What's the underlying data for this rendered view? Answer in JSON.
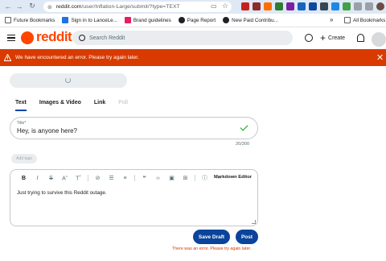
{
  "browser": {
    "url_host": "reddit.com",
    "url_path": "/user/Inflation-Large/submit/?type=TEXT",
    "bookmarks": [
      {
        "label": "Future Bookmarks",
        "icon": "folder-icon"
      },
      {
        "label": "Sign in to LanceLe...",
        "icon": "page-icon"
      },
      {
        "label": "Brand guidelines",
        "icon": "page-icon"
      },
      {
        "label": "Page Report",
        "icon": "page-icon"
      },
      {
        "label": "New Paid Contribu...",
        "icon": "page-icon"
      }
    ],
    "all_bookmarks": "All Bookmarks",
    "more": "»"
  },
  "header": {
    "logo": "reddit",
    "search_placeholder": "Search Reddit",
    "create_label": "Create"
  },
  "error_banner": {
    "message": "We have encountered an error. Please try again later.",
    "color": "#d93a00"
  },
  "composer": {
    "tabs": [
      {
        "label": "Text",
        "state": "active"
      },
      {
        "label": "Images & Video",
        "state": "normal"
      },
      {
        "label": "Link",
        "state": "normal"
      },
      {
        "label": "Poll",
        "state": "disabled"
      }
    ],
    "title_label": "Title*",
    "title_value": "Hey, is anyone here?",
    "title_counter": "20/300",
    "add_tags": "Add tags",
    "markdown_editor": "Markdown Editor",
    "body_text": "Just trying to survive this Reddit outage.",
    "save_draft": "Save Draft",
    "post": "Post",
    "error_footer": "There was an error. Please try again later."
  },
  "colors": {
    "brand": "#ff4500",
    "button": "#0a449b",
    "success_check": "#01a816"
  }
}
